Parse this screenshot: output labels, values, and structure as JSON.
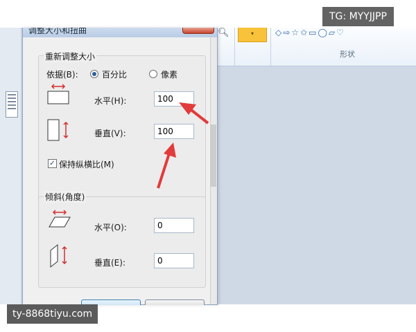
{
  "dialog": {
    "title": "调整大小和扭曲",
    "resize_group": {
      "title": "重新调整大小",
      "basis_label": "依据(B):",
      "options": [
        "百分比",
        "像素"
      ],
      "selected_option": "百分比",
      "horizontal_label": "水平(H):",
      "horizontal_value": "100",
      "vertical_label": "垂直(V):",
      "vertical_value": "100",
      "keep_ratio_label": "保持纵横比(M)",
      "keep_ratio_checked": true
    },
    "skew_group": {
      "title": "倾斜(角度)",
      "horizontal_label": "水平(O):",
      "horizontal_value": "0",
      "vertical_label": "垂直(E):",
      "vertical_value": "0"
    }
  },
  "ribbon": {
    "shapes_label": "形状",
    "shape_icons": [
      "rhombus-icon",
      "arrow-icon",
      "star-icon",
      "star-icon",
      "callout-icon",
      "callout-icon",
      "callout-icon",
      "heart-icon"
    ]
  },
  "overlays": {
    "watermark": "TG: MYYJJPP",
    "site_badge": "ty-8868tiyu.com"
  },
  "colors": {
    "annotation_arrow": "#e23b3b",
    "dialog_bg": "#f0f0f0",
    "canvas_bg": "#cfd9e6",
    "color_button": "#f8c33a"
  }
}
